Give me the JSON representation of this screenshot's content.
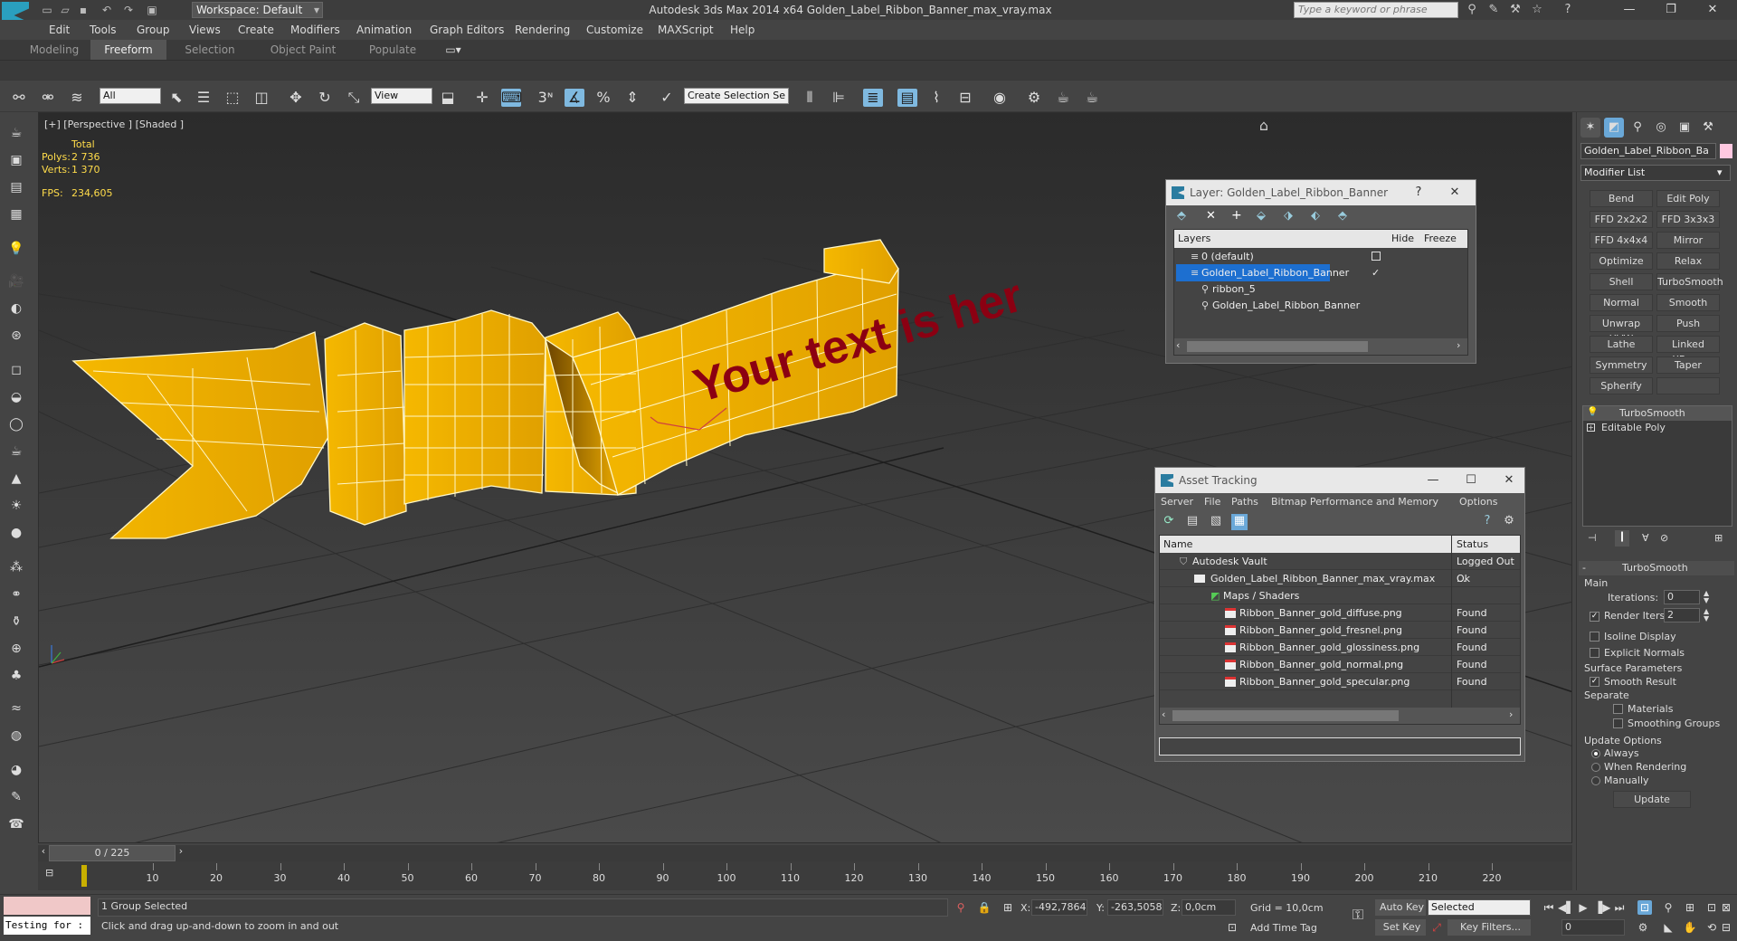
{
  "titlebar": {
    "workspace": "Workspace: Default",
    "title": "Autodesk 3ds Max  2014 x64     Golden_Label_Ribbon_Banner_max_vray.max",
    "search_placeholder": "Type a keyword or phrase"
  },
  "menu": [
    "Edit",
    "Tools",
    "Group",
    "Views",
    "Create",
    "Modifiers",
    "Animation",
    "Graph Editors",
    "Rendering",
    "Customize",
    "MAXScript",
    "Help"
  ],
  "ribbon_tabs": [
    "Modeling",
    "Freeform",
    "Selection",
    "Object Paint",
    "Populate"
  ],
  "ribbon_active": "Freeform",
  "toolbar": {
    "filter": "All",
    "coord_system": "View",
    "selection_set": "Create Selection Se",
    "snap_3": "3",
    "snap_percent": "%"
  },
  "viewport": {
    "label": "[+] [Perspective ] [Shaded ]",
    "stats_header": "Total",
    "polys_label": "Polys:",
    "polys_value": "2 736",
    "verts_label": "Verts:",
    "verts_value": "1 370",
    "fps_label": "FPS:",
    "fps_value": "234,605",
    "banner_text": "Your text is her"
  },
  "layer_dialog": {
    "title": "Layer: Golden_Label_Ribbon_Banner",
    "col_layers": "Layers",
    "col_hide": "Hide",
    "col_freeze": "Freeze",
    "rows": [
      "0 (default)",
      "Golden_Label_Ribbon_Banner",
      "ribbon_5",
      "Golden_Label_Ribbon_Banner"
    ]
  },
  "asset_dialog": {
    "title": "Asset Tracking",
    "menu": [
      "Server",
      "File",
      "Paths",
      "Bitmap Performance and Memory",
      "Options"
    ],
    "col_name": "Name",
    "col_status": "Status",
    "rows": [
      {
        "name": "Autodesk Vault",
        "status": "Logged Out ..."
      },
      {
        "name": "Golden_Label_Ribbon_Banner_max_vray.max",
        "status": "Ok"
      },
      {
        "name": "Maps / Shaders",
        "status": ""
      },
      {
        "name": "Ribbon_Banner_gold_diffuse.png",
        "status": "Found"
      },
      {
        "name": "Ribbon_Banner_gold_fresnel.png",
        "status": "Found"
      },
      {
        "name": "Ribbon_Banner_gold_glossiness.png",
        "status": "Found"
      },
      {
        "name": "Ribbon_Banner_gold_normal.png",
        "status": "Found"
      },
      {
        "name": "Ribbon_Banner_gold_specular.png",
        "status": "Found"
      }
    ]
  },
  "command_panel": {
    "object_name": "Golden_Label_Ribbon_Ba",
    "modifier_list": "Modifier List",
    "modifier_buttons": [
      "Bend",
      "Edit Poly",
      "FFD 2x2x2",
      "FFD 3x3x3",
      "FFD 4x4x4",
      "Mirror",
      "Optimize",
      "Relax",
      "Shell",
      "TurboSmooth",
      "Normal",
      "Smooth",
      "Unwrap UVW",
      "Push",
      "Lathe",
      "Linked XForm",
      "Symmetry",
      "Taper",
      "Spherify",
      ""
    ],
    "stack": [
      "TurboSmooth",
      "Editable Poly"
    ],
    "rollout_title": "TurboSmooth",
    "main_label": "Main",
    "iterations_label": "Iterations:",
    "iterations_value": "0",
    "render_iters_label": "Render Iters:",
    "render_iters_value": "2",
    "isoline": "Isoline Display",
    "explicit_normals": "Explicit Normals",
    "surface_params": "Surface Parameters",
    "smooth_result": "Smooth Result",
    "separate": "Separate",
    "materials": "Materials",
    "smoothing_groups": "Smoothing Groups",
    "update_options": "Update Options",
    "always": "Always",
    "when_rendering": "When Rendering",
    "manually": "Manually",
    "update_btn": "Update"
  },
  "timeline": {
    "frame": "0 / 225",
    "ticks": [
      "10",
      "20",
      "30",
      "40",
      "50",
      "60",
      "70",
      "80",
      "90",
      "100",
      "110",
      "120",
      "130",
      "140",
      "150",
      "160",
      "170",
      "180",
      "190",
      "200",
      "210",
      "220"
    ]
  },
  "statusbar": {
    "script_listener": "Testing for :",
    "selected": "1 Group Selected",
    "prompt": "Click and drag up-and-down to zoom in and out",
    "x_label": "X:",
    "x_value": "-492,7864",
    "y_label": "Y:",
    "y_value": "-263,5058",
    "z_label": "Z:",
    "z_value": "0,0cm",
    "grid": "Grid = 10,0cm",
    "add_time_tag": "Add Time Tag",
    "auto_key": "Auto Key",
    "set_key": "Set Key",
    "key_mode": "Selected",
    "key_filters": "Key Filters...",
    "current_frame": "0"
  }
}
